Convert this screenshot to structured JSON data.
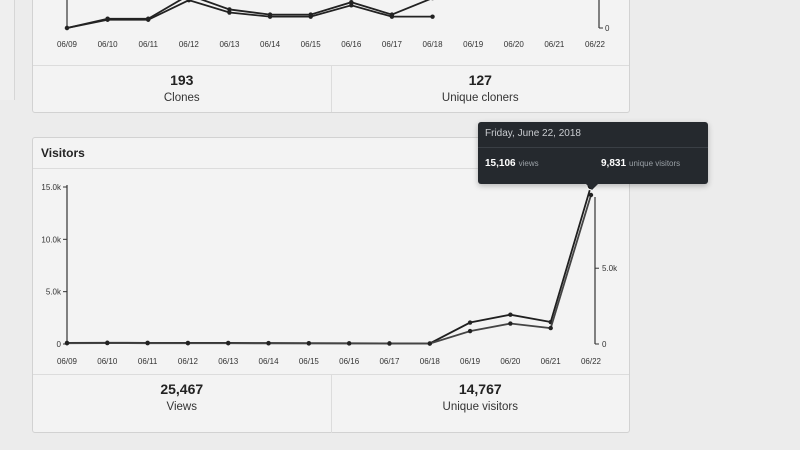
{
  "clones_card": {
    "title": "",
    "dates": [
      "06/09",
      "06/10",
      "06/11",
      "06/12",
      "06/13",
      "06/14",
      "06/15",
      "06/16",
      "06/17",
      "06/18",
      "06/19",
      "06/20",
      "06/21",
      "06/22"
    ],
    "right_axis_zero": "0",
    "stats": [
      {
        "value": "193",
        "label": "Clones"
      },
      {
        "value": "127",
        "label": "Unique cloners"
      }
    ]
  },
  "visitors_card": {
    "title": "Visitors",
    "stats": [
      {
        "value": "25,467",
        "label": "Views"
      },
      {
        "value": "14,767",
        "label": "Unique visitors"
      }
    ]
  },
  "tooltip": {
    "date": "Friday, June 22, 2018",
    "views_value": "15,106",
    "views_label": "views",
    "uniques_value": "9,831",
    "uniques_label": "unique visitors"
  },
  "chart_data": [
    {
      "type": "line",
      "title": "",
      "x": [
        "06/09",
        "06/10",
        "06/11",
        "06/12",
        "06/13",
        "06/14",
        "06/15",
        "06/16",
        "06/17",
        "06/18",
        "06/19",
        "06/20",
        "06/21",
        "06/22"
      ],
      "series": [
        {
          "name": "",
          "values": [
            0,
            9,
            9,
            32,
            18,
            13,
            13,
            25,
            13,
            29,
            0,
            0,
            0,
            0
          ]
        },
        {
          "name": "",
          "values": [
            0,
            8,
            8,
            27,
            15,
            11,
            11,
            22,
            11,
            11,
            0,
            0,
            0,
            0
          ]
        }
      ],
      "visible_x_range": [
        "06/09",
        "06/18"
      ],
      "grid": false
    },
    {
      "type": "line",
      "title": "Visitors",
      "x": [
        "06/09",
        "06/10",
        "06/11",
        "06/12",
        "06/13",
        "06/14",
        "06/15",
        "06/16",
        "06/17",
        "06/18",
        "06/19",
        "06/20",
        "06/21",
        "06/22"
      ],
      "left_axis": {
        "ticks": [
          "0",
          "5.0k",
          "10.0k",
          "15.0k"
        ],
        "range": [
          0,
          15000
        ]
      },
      "right_axis": {
        "ticks": [
          "0",
          "5.0k"
        ],
        "range": [
          0,
          9831
        ]
      },
      "series": [
        {
          "name": "views",
          "axis": "left",
          "values": [
            100,
            120,
            110,
            100,
            100,
            90,
            80,
            70,
            60,
            50,
            2050,
            2800,
            2100,
            15106
          ]
        },
        {
          "name": "unique visitors",
          "axis": "right",
          "values": [
            50,
            60,
            55,
            50,
            50,
            45,
            40,
            35,
            30,
            25,
            850,
            1350,
            1050,
            9831
          ]
        }
      ],
      "highlight_point": {
        "x": "06/22",
        "series": "views",
        "value": 15106
      },
      "grid": false
    }
  ]
}
